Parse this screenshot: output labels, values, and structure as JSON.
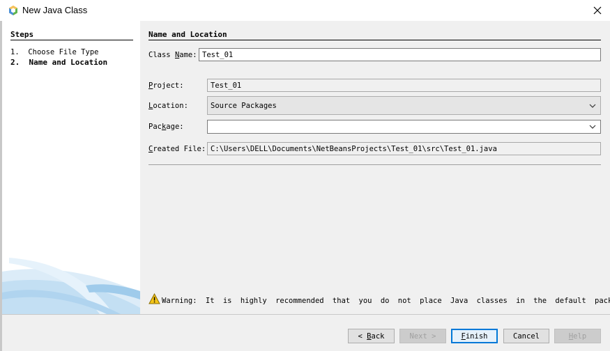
{
  "window": {
    "title": "New Java Class"
  },
  "steps": {
    "heading": "Steps",
    "items": [
      {
        "number": "1.",
        "label": "Choose File Type",
        "active": false
      },
      {
        "number": "2.",
        "label": "Name and Location",
        "active": true
      }
    ]
  },
  "form": {
    "heading": "Name and Location",
    "class_name_label": "Class Name:",
    "class_name_value": "Test_01",
    "project_label": "Project:",
    "project_value": "Test_01",
    "location_label": "Location:",
    "location_value": "Source Packages",
    "package_label": "Package:",
    "package_value": "",
    "created_file_label": "Created File:",
    "created_file_value": "C:\\Users\\DELL\\Documents\\NetBeansProjects\\Test_01\\src\\Test_01.java"
  },
  "warning": {
    "text": "Warning: It is highly recommended that you do not place Java classes in the default package."
  },
  "buttons": {
    "back": "< Back",
    "next": "Next >",
    "finish": "Finish",
    "cancel": "Cancel",
    "help": "Help"
  },
  "colors": {
    "dialog_bg": "#f0f0f0",
    "default_button_border": "#0078d7",
    "warning_yellow": "#f5c518"
  }
}
